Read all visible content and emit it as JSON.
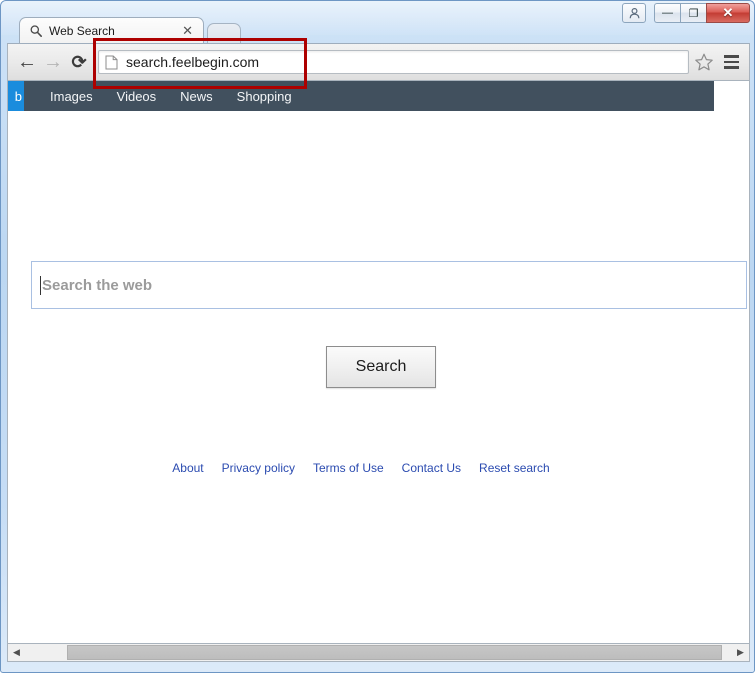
{
  "window": {
    "controls": {
      "user_account_icon": "user-account-icon",
      "minimize_label": "—",
      "maximize_label": "❐",
      "close_label": "✕"
    }
  },
  "tabs": [
    {
      "title": "Web Search",
      "favicon": "magnifier-icon",
      "close_label": "✕"
    }
  ],
  "toolbar": {
    "back_label": "←",
    "forward_label": "→",
    "reload_label": "⟳",
    "address_value": "search.feelbegin.com",
    "page_icon": "page-document-icon",
    "bookmark_icon": "star-icon",
    "menu_icon": "hamburger-menu-icon"
  },
  "site_nav": {
    "web_tab_label": "b",
    "items": [
      {
        "label": "Images"
      },
      {
        "label": "Videos"
      },
      {
        "label": "News"
      },
      {
        "label": "Shopping"
      }
    ]
  },
  "search": {
    "placeholder": "Search the web",
    "value": "",
    "button_label": "Search"
  },
  "footer": {
    "links": [
      {
        "label": "About"
      },
      {
        "label": "Privacy policy"
      },
      {
        "label": "Terms of Use"
      },
      {
        "label": "Contact Us"
      },
      {
        "label": "Reset search"
      }
    ]
  },
  "scrollbar": {
    "left_arrow": "◀",
    "right_arrow": "▶"
  },
  "annotation": {
    "highlight_color": "#ad0000",
    "target": "address-bar"
  }
}
